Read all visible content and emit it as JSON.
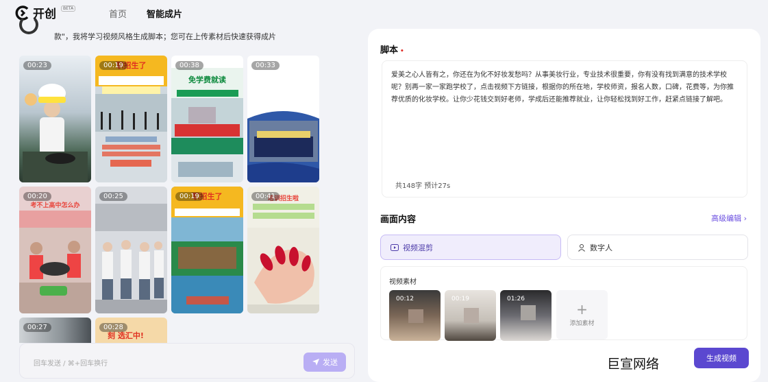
{
  "nav": {
    "logo_text": "开创",
    "beta": "BETA",
    "home": "首页",
    "smart": "智能成片"
  },
  "chat": {
    "intro": "款\"，我将学习视频风格生成脚本；您可在上传素材后快速获得成片",
    "input_placeholder": "回车发送 / ⌘+回车换行",
    "send_label": "发送"
  },
  "videos": [
    {
      "duration": "00:23"
    },
    {
      "duration": "00:19",
      "overlay": "职招生了"
    },
    {
      "duration": "00:38",
      "overlay": "免学费就读"
    },
    {
      "duration": "00:33"
    },
    {
      "duration": "00:20",
      "overlay": "考不上高中怎么办"
    },
    {
      "duration": "00:25"
    },
    {
      "duration": "00:19",
      "overlay": "职招生了"
    },
    {
      "duration": "00:41",
      "overlay": "培训招生啦"
    },
    {
      "duration": "00:27"
    },
    {
      "duration": "00:28",
      "overlay": "刻 选汇中!"
    }
  ],
  "script": {
    "label": "脚本",
    "required_mark": "•",
    "text": "爱美之心人皆有之，你还在为化不好妆发愁吗？从事美妆行业，专业技术很重要，你有没有找到满意的技术学校呢？别再一家一家跑学校了，点击视频下方链接，根据你的所在地，学校师资，报名人数，口碑，花费等，为你推荐优质的化妆学校。让你少花钱交到好老师，学成后还能推荐就业，让你轻松找到好工作，赶紧点链接了解吧。",
    "count": "共148字 预计27s"
  },
  "content": {
    "label": "画面内容",
    "advanced": "高级编辑",
    "mode_video": "视频混剪",
    "mode_human": "数字人",
    "material_label": "视频素材",
    "materials": [
      {
        "duration": "00:12"
      },
      {
        "duration": "00:19"
      },
      {
        "duration": "01:26"
      }
    ],
    "add_label": "添加素材"
  },
  "footer": {
    "brand": "巨宣网络",
    "generate": "生成视频"
  },
  "colors": {
    "accent": "#5b48d0",
    "accent_light": "#b9aef4",
    "required": "#e0302a"
  }
}
